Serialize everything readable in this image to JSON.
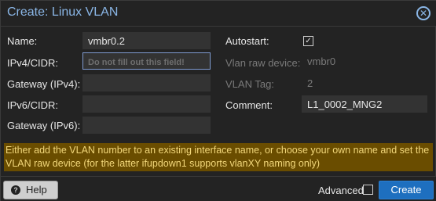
{
  "dialog": {
    "title": "Create: Linux VLAN",
    "close_symbol": "✕"
  },
  "form": {
    "name_label": "Name:",
    "name_value": "vmbr0.2",
    "ipv4_label": "IPv4/CIDR:",
    "ipv4_placeholder": "Do not fill out this field!",
    "gateway_ipv4_label": "Gateway (IPv4):",
    "gateway_ipv4_value": "",
    "ipv6_label": "IPv6/CIDR:",
    "ipv6_value": "",
    "gateway_ipv6_label": "Gateway (IPv6):",
    "gateway_ipv6_value": "",
    "autostart_label": "Autostart:",
    "autostart_checked": true,
    "autostart_symbol": "✓",
    "vlan_raw_device_label": "Vlan raw device:",
    "vlan_raw_device_value": "vmbr0",
    "vlan_tag_label": "VLAN Tag:",
    "vlan_tag_value": "2",
    "comment_label": "Comment:",
    "comment_value": "L1_0002_MNG2"
  },
  "notice": {
    "text": "Either add the VLAN number to an existing interface name, or choose your own name and set the VLAN raw device (for the latter ifupdown1 supports vlanXY naming only)"
  },
  "footer": {
    "help_label": "Help",
    "help_icon_symbol": "?",
    "advanced_label": "Advanced",
    "advanced_checked": false,
    "create_label": "Create"
  },
  "colors": {
    "accent": "#8ab6e6",
    "primary_button": "#1e6fbf",
    "notice_bg": "#6a4d00",
    "notice_text": "#f2d77a"
  }
}
